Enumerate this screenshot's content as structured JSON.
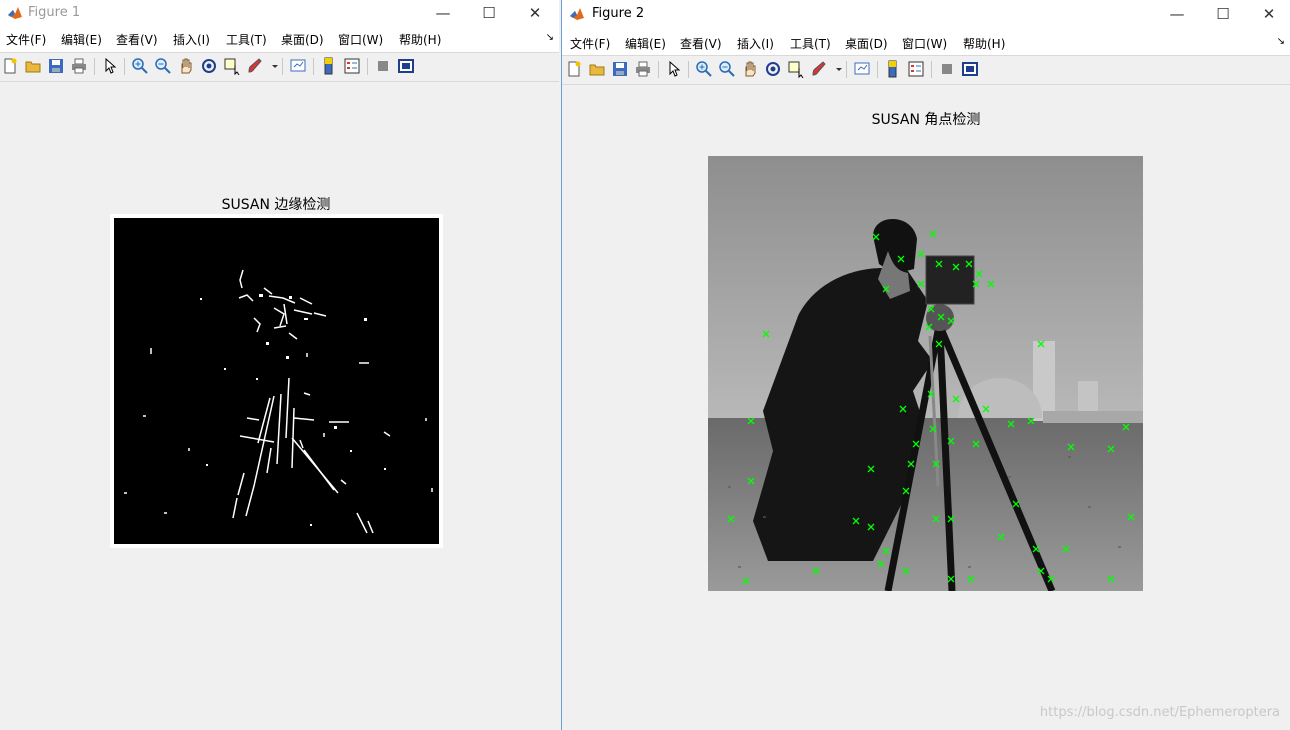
{
  "figure1": {
    "title": "Figure 1",
    "menu": [
      "文件(F)",
      "编辑(E)",
      "查看(V)",
      "插入(I)",
      "工具(T)",
      "桌面(D)",
      "窗口(W)",
      "帮助(H)"
    ],
    "plot_title": "SUSAN  边缘检测"
  },
  "figure2": {
    "title": "Figure 2",
    "menu": [
      "文件(F)",
      "编辑(E)",
      "查看(V)",
      "插入(I)",
      "工具(T)",
      "桌面(D)",
      "窗口(W)",
      "帮助(H)"
    ],
    "plot_title": "SUSAN  角点检测"
  },
  "window_controls": {
    "minimize": "—",
    "maximize": "☐",
    "close": "✕"
  },
  "toolbar_icons": [
    "new-figure-icon",
    "open-file-icon",
    "save-icon",
    "print-icon",
    "select-arrow-icon",
    "zoom-in-icon",
    "zoom-out-icon",
    "pan-hand-icon",
    "rotate-3d-icon",
    "data-cursor-icon",
    "brush-icon",
    "link-plot-icon",
    "colorbar-icon",
    "legend-icon",
    "hide-plot-tools-icon",
    "show-plot-tools-icon"
  ],
  "colors": {
    "accent_border": "#6d9fd6",
    "corner_marker": "#00ff00",
    "edge_image_bg": "#000000"
  },
  "watermark": "https://blog.csdn.net/Ephemeroptera"
}
